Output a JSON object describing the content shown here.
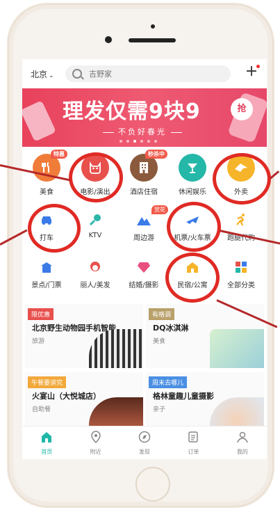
{
  "topbar": {
    "city": "北京",
    "search_placeholder": "吉野家"
  },
  "banner": {
    "headline": "理发仅需9块9",
    "grab": "抢",
    "sub": "不负好春光"
  },
  "grid_row1": [
    {
      "label": "美食",
      "tag": "特惠",
      "color": "#f07c3a"
    },
    {
      "label": "电影/演出",
      "tag": "",
      "color": "#e8504c"
    },
    {
      "label": "酒店住宿",
      "tag": "秒杀中",
      "color": "#8b5a3c"
    },
    {
      "label": "休闲娱乐",
      "tag": "",
      "color": "#25b7a8"
    },
    {
      "label": "外卖",
      "tag": "",
      "color": "#f6b42a"
    }
  ],
  "grid_row2": [
    {
      "label": "打车",
      "tag": ""
    },
    {
      "label": "KTV",
      "tag": ""
    },
    {
      "label": "周边游",
      "tag": "赏花"
    },
    {
      "label": "机票/火车票",
      "tag": ""
    },
    {
      "label": "跑腿代购",
      "tag": ""
    }
  ],
  "grid_row3": [
    {
      "label": "景点/门票"
    },
    {
      "label": "丽人/美发"
    },
    {
      "label": "结婚/摄影"
    },
    {
      "label": "民宿/公寓"
    },
    {
      "label": "全部分类"
    }
  ],
  "cards": [
    {
      "tag": "限优惠",
      "title": "北京野生动物园手机智能...",
      "sub": "旅游",
      "tag_color": "#e8504c"
    },
    {
      "tag": "有格调",
      "title": "DQ冰淇淋",
      "sub": "美食",
      "tag_color": "#b9a06a"
    },
    {
      "tag": "午餐要讲究",
      "title": "火宴山（大悦城店）",
      "sub": "自助餐",
      "tag_color": "#f2a93b"
    },
    {
      "tag": "周末去哪儿",
      "title": "格林童趣儿童摄影",
      "sub": "亲子",
      "tag_color": "#4a8fe3"
    }
  ],
  "tabbar": [
    {
      "label": "首页",
      "icon": "home-icon"
    },
    {
      "label": "附近",
      "icon": "location-icon"
    },
    {
      "label": "发现",
      "icon": "compass-icon"
    },
    {
      "label": "订单",
      "icon": "order-icon"
    },
    {
      "label": "我的",
      "icon": "profile-icon"
    }
  ]
}
